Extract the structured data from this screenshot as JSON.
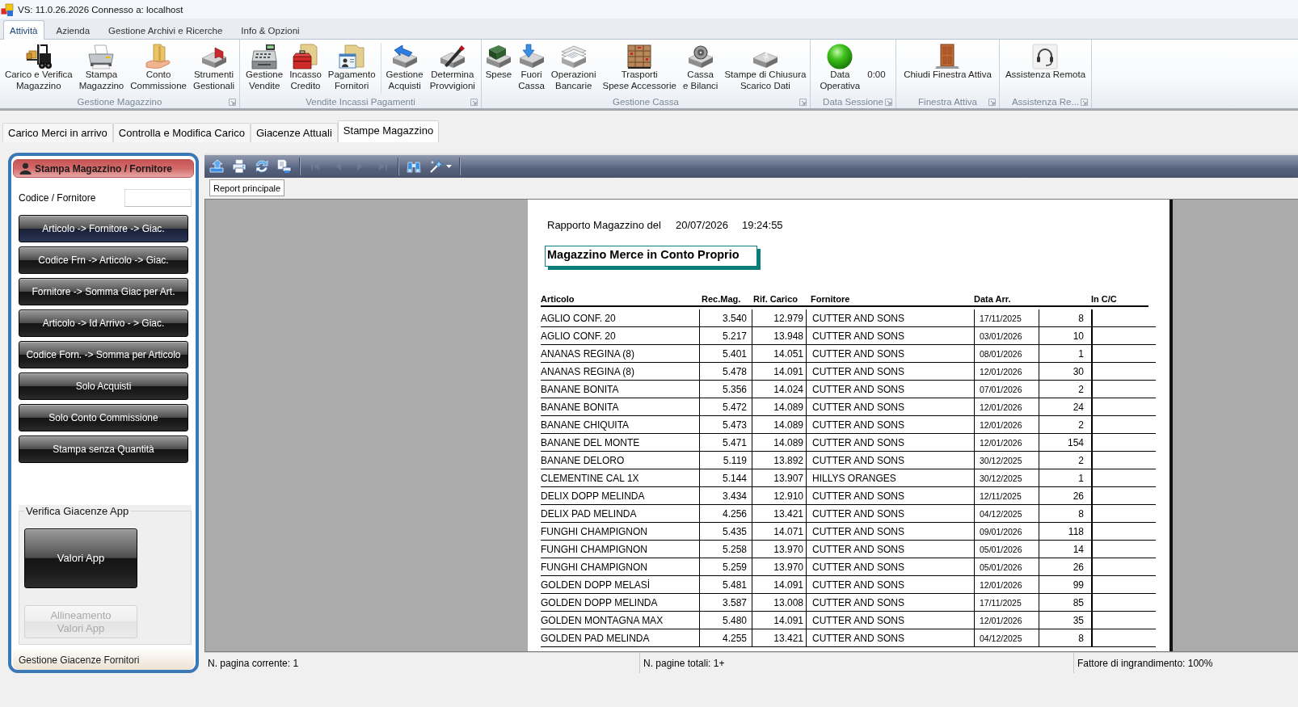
{
  "window": {
    "title": "VS: 11.0.26.2026 Connesso a: localhost"
  },
  "ribbon": {
    "tabs": [
      {
        "label": "Attività",
        "selected": true
      },
      {
        "label": "Azienda",
        "selected": false
      },
      {
        "label": "Gestione Archivi e Ricerche",
        "selected": false
      },
      {
        "label": "Info & Opzioni",
        "selected": false
      }
    ],
    "groups": [
      {
        "label": "Gestione Magazzino",
        "sections": [
          {
            "items": [
              {
                "kind": "button",
                "lines": [
                  "Carico e Verifica",
                  "Magazzino"
                ]
              },
              {
                "kind": "button",
                "lines": [
                  "Stampa",
                  "Magazzino"
                ]
              },
              {
                "kind": "button",
                "lines": [
                  "Conto",
                  "Commissione"
                ]
              },
              {
                "kind": "button",
                "lines": [
                  "Strumenti",
                  "Gestionali"
                ]
              }
            ]
          }
        ]
      },
      {
        "label": "Vendite Incassi Pagamenti",
        "sections": [
          {
            "items": [
              {
                "kind": "button",
                "lines": [
                  "Gestione",
                  "Vendite"
                ]
              },
              {
                "kind": "button",
                "lines": [
                  "Incasso",
                  "Credito"
                ]
              },
              {
                "kind": "button",
                "lines": [
                  "Pagamento",
                  "Fornitori"
                ]
              }
            ]
          },
          {
            "items": [
              {
                "kind": "button",
                "lines": [
                  "Gestione",
                  "Acquisti"
                ]
              },
              {
                "kind": "button",
                "lines": [
                  "Determina",
                  "Provvigioni"
                ]
              }
            ]
          }
        ]
      },
      {
        "label": "Gestione Cassa",
        "sections": [
          {
            "items": [
              {
                "kind": "button",
                "lines": [
                  "Spese"
                ]
              },
              {
                "kind": "button",
                "lines": [
                  "Fuori",
                  "Cassa"
                ]
              },
              {
                "kind": "button",
                "lines": [
                  "Operazioni",
                  "Bancarie"
                ]
              },
              {
                "kind": "button",
                "lines": [
                  "Trasporti",
                  "Spese Accessorie"
                ]
              },
              {
                "kind": "button",
                "lines": [
                  "Cassa",
                  "e Bilanci"
                ]
              },
              {
                "kind": "button",
                "lines": [
                  "Stampe di Chiusura",
                  "Scarico Dati"
                ]
              }
            ]
          }
        ]
      },
      {
        "label": "Data Sessione",
        "sections": [
          {
            "items": [
              {
                "kind": "button",
                "lines": [
                  "Data",
                  "Operativa"
                ]
              },
              {
                "kind": "text",
                "text": "0:00"
              }
            ]
          }
        ]
      },
      {
        "label": "Finestra Attiva",
        "sections": [
          {
            "items": [
              {
                "kind": "button",
                "lines": [
                  "Chiudi Finestra Attiva"
                ]
              }
            ]
          }
        ]
      },
      {
        "label": "Assistenza Re...",
        "sections": [
          {
            "items": [
              {
                "kind": "button",
                "lines": [
                  "Assistenza Remota"
                ]
              }
            ]
          }
        ]
      }
    ]
  },
  "document_tabs": [
    {
      "label": "Carico Merci in arrivo",
      "selected": false
    },
    {
      "label": "Controlla e Modifica Carico",
      "selected": false
    },
    {
      "label": "Giacenze Attuali",
      "selected": false
    },
    {
      "label": "Stampe Magazzino",
      "selected": true
    }
  ],
  "supplier_panel": {
    "title": "Stampa Magazzino / Fornitore",
    "code_label": "Codice / Fornitore",
    "buttons": [
      {
        "label": "Articolo -> Fornitore -> Giac.",
        "focused": true
      },
      {
        "label": "Codice Frn -> Articolo -> Giac.",
        "focused": false
      },
      {
        "label": "Fornitore -> Somma Giac per Art.",
        "focused": false
      },
      {
        "label": "Articolo -> Id Arrivo - > Giac.",
        "focused": false
      },
      {
        "label": "Codice Forn. -> Somma per Articolo",
        "focused": false
      },
      {
        "label": "Solo Acquisti",
        "focused": false
      },
      {
        "label": "Solo Conto Commissione",
        "focused": false
      },
      {
        "label": "Stampa senza Quantità",
        "focused": false
      }
    ],
    "group": {
      "title": "Verifica Giacenze App",
      "buttons": [
        {
          "lines": [
            "Valori App"
          ],
          "disabled": false
        },
        {
          "lines": [
            "Allineamento",
            "Valori App"
          ],
          "disabled": true
        }
      ]
    },
    "footer": "Gestione Giacenze Fornitori"
  },
  "report_viewer": {
    "toolbar": {
      "sections": [
        {
          "buttons": [
            {
              "kind": "button",
              "disabled": false
            },
            {
              "kind": "button",
              "disabled": false
            },
            {
              "kind": "button",
              "disabled": false
            },
            {
              "kind": "button",
              "disabled": false
            }
          ]
        },
        {
          "buttons": [
            {
              "kind": "button",
              "disabled": true
            },
            {
              "kind": "button",
              "disabled": true
            },
            {
              "kind": "button",
              "disabled": true
            },
            {
              "kind": "button",
              "disabled": true
            }
          ]
        },
        {
          "buttons": [
            {
              "kind": "button",
              "disabled": false
            },
            {
              "kind": "dropdown",
              "disabled": false
            }
          ]
        }
      ]
    },
    "tabs": [
      {
        "label": "Report principale",
        "selected": true
      }
    ],
    "page": {
      "heading": "Rapporto Magazzino del",
      "date": "20/07/2026",
      "time": "19:24:55",
      "title": "Magazzino Merce in Conto Proprio",
      "columns": [
        "Articolo",
        "Rec.Mag.",
        "Rif. Carico",
        "Fornitore",
        "Data Arr.",
        "In C/C"
      ],
      "rows": [
        {
          "articolo": "AGLIO CONF. 20",
          "rec_mag": "3.540",
          "rif_carico": "12.979",
          "fornitore": "CUTTER AND SONS",
          "data_arr": "17/11/2025",
          "column_6": "8"
        },
        {
          "articolo": "AGLIO CONF. 20",
          "rec_mag": "5.217",
          "rif_carico": "13.948",
          "fornitore": "CUTTER AND SONS",
          "data_arr": "03/01/2026",
          "column_6": "10"
        },
        {
          "articolo": "ANANAS REGINA (8)",
          "rec_mag": "5.401",
          "rif_carico": "14.051",
          "fornitore": "CUTTER AND SONS",
          "data_arr": "08/01/2026",
          "column_6": "1"
        },
        {
          "articolo": "ANANAS REGINA (8)",
          "rec_mag": "5.478",
          "rif_carico": "14.091",
          "fornitore": "CUTTER AND SONS",
          "data_arr": "12/01/2026",
          "column_6": "30"
        },
        {
          "articolo": "BANANE BONITA",
          "rec_mag": "5.356",
          "rif_carico": "14.024",
          "fornitore": "CUTTER AND SONS",
          "data_arr": "07/01/2026",
          "column_6": "2"
        },
        {
          "articolo": "BANANE BONITA",
          "rec_mag": "5.472",
          "rif_carico": "14.089",
          "fornitore": "CUTTER AND SONS",
          "data_arr": "12/01/2026",
          "column_6": "24"
        },
        {
          "articolo": "BANANE CHIQUITA",
          "rec_mag": "5.473",
          "rif_carico": "14.089",
          "fornitore": "CUTTER AND SONS",
          "data_arr": "12/01/2026",
          "column_6": "2"
        },
        {
          "articolo": "BANANE DEL MONTE",
          "rec_mag": "5.471",
          "rif_carico": "14.089",
          "fornitore": "CUTTER AND SONS",
          "data_arr": "12/01/2026",
          "column_6": "154"
        },
        {
          "articolo": "BANANE DELORO",
          "rec_mag": "5.119",
          "rif_carico": "13.892",
          "fornitore": "CUTTER AND SONS",
          "data_arr": "30/12/2025",
          "column_6": "2"
        },
        {
          "articolo": "CLEMENTINE CAL 1X",
          "rec_mag": "5.144",
          "rif_carico": "13.907",
          "fornitore": "HILLYS ORANGES",
          "data_arr": "30/12/2025",
          "column_6": "1"
        },
        {
          "articolo": "DELIX DOPP MELINDA",
          "rec_mag": "3.434",
          "rif_carico": "12.910",
          "fornitore": "CUTTER AND SONS",
          "data_arr": "12/11/2025",
          "column_6": "26"
        },
        {
          "articolo": "DELIX PAD MELINDA",
          "rec_mag": "4.256",
          "rif_carico": "13.421",
          "fornitore": "CUTTER AND SONS",
          "data_arr": "04/12/2025",
          "column_6": "8"
        },
        {
          "articolo": "FUNGHI CHAMPIGNON",
          "rec_mag": "5.435",
          "rif_carico": "14.071",
          "fornitore": "CUTTER AND SONS",
          "data_arr": "09/01/2026",
          "column_6": "118"
        },
        {
          "articolo": "FUNGHI CHAMPIGNON",
          "rec_mag": "5.258",
          "rif_carico": "13.970",
          "fornitore": "CUTTER AND SONS",
          "data_arr": "05/01/2026",
          "column_6": "14"
        },
        {
          "articolo": "FUNGHI CHAMPIGNON",
          "rec_mag": "5.259",
          "rif_carico": "13.970",
          "fornitore": "CUTTER AND SONS",
          "data_arr": "05/01/2026",
          "column_6": "26"
        },
        {
          "articolo": "GOLDEN DOPP MELASİ",
          "rec_mag": "5.481",
          "rif_carico": "14.091",
          "fornitore": "CUTTER AND SONS",
          "data_arr": "12/01/2026",
          "column_6": "99"
        },
        {
          "articolo": "GOLDEN DOPP MELINDA",
          "rec_mag": "3.587",
          "rif_carico": "13.008",
          "fornitore": "CUTTER AND SONS",
          "data_arr": "17/11/2025",
          "column_6": "85"
        },
        {
          "articolo": "GOLDEN MONTAGNA MAX",
          "rec_mag": "5.480",
          "rif_carico": "14.091",
          "fornitore": "CUTTER AND SONS",
          "data_arr": "12/01/2026",
          "column_6": "35"
        },
        {
          "articolo": "GOLDEN PAD MELINDA",
          "rec_mag": "4.255",
          "rif_carico": "13.421",
          "fornitore": "CUTTER AND SONS",
          "data_arr": "04/12/2025",
          "column_6": "8"
        }
      ]
    },
    "status_bar": [
      "N. pagina corrente: 1",
      "N. pagine totali: 1+",
      "Fattore di ingrandimento: 100%"
    ]
  }
}
